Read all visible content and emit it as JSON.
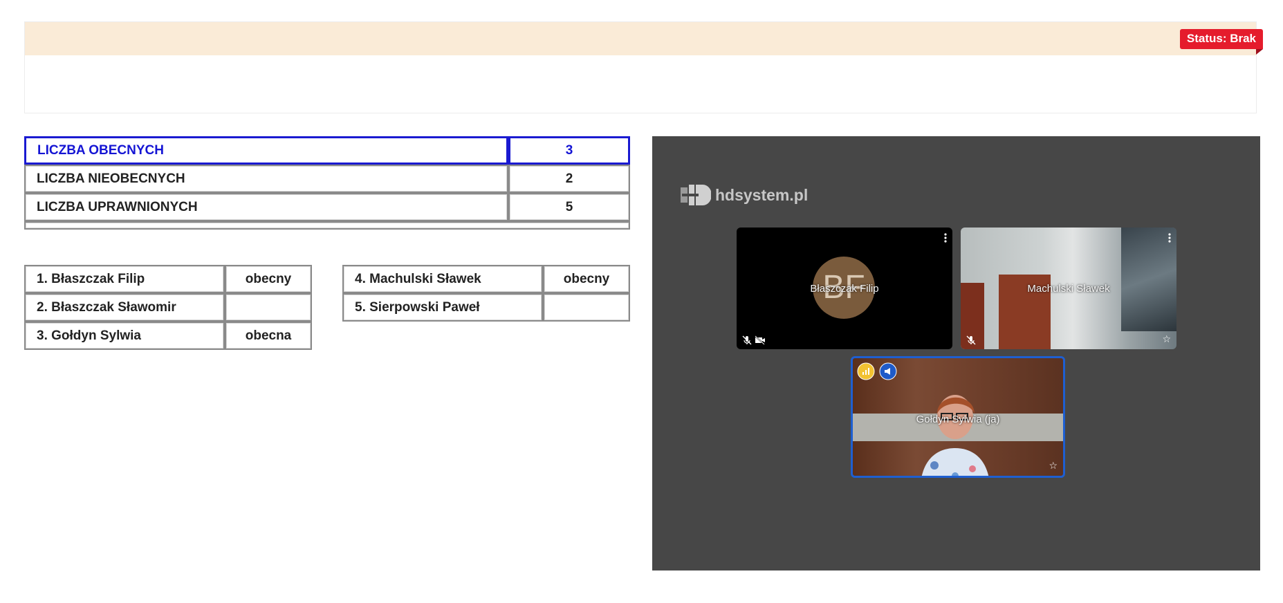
{
  "header": {
    "status": "Status: Brak"
  },
  "summary": {
    "rows": [
      {
        "label": "LICZBA OBECNYCH",
        "value": "3"
      },
      {
        "label": "LICZBA NIEOBECNYCH",
        "value": "2"
      },
      {
        "label": "LICZBA UPRAWNIONYCH",
        "value": "5"
      }
    ]
  },
  "members": {
    "left": [
      {
        "name": "1. Błaszczak Filip",
        "status": "obecny"
      },
      {
        "name": "2. Błaszczak Sławomir",
        "status": ""
      },
      {
        "name": "3. Gołdyn Sylwia",
        "status": "obecna"
      }
    ],
    "right": [
      {
        "name": "4. Machulski Sławek",
        "status": "obecny"
      },
      {
        "name": "5. Sierpowski Paweł",
        "status": ""
      }
    ]
  },
  "video": {
    "logo_text": "hdsystem.pl",
    "tiles": [
      {
        "name": "Błaszczak Filip",
        "initials": "BF"
      },
      {
        "name": "Machulski Sławek"
      },
      {
        "name": "Gołdyn Sylwia (ja)"
      }
    ],
    "colors": {
      "speaking_border": "#1e5fd1",
      "badge_yellow": "#f2c232",
      "badge_blue": "#1f5bc9"
    }
  }
}
